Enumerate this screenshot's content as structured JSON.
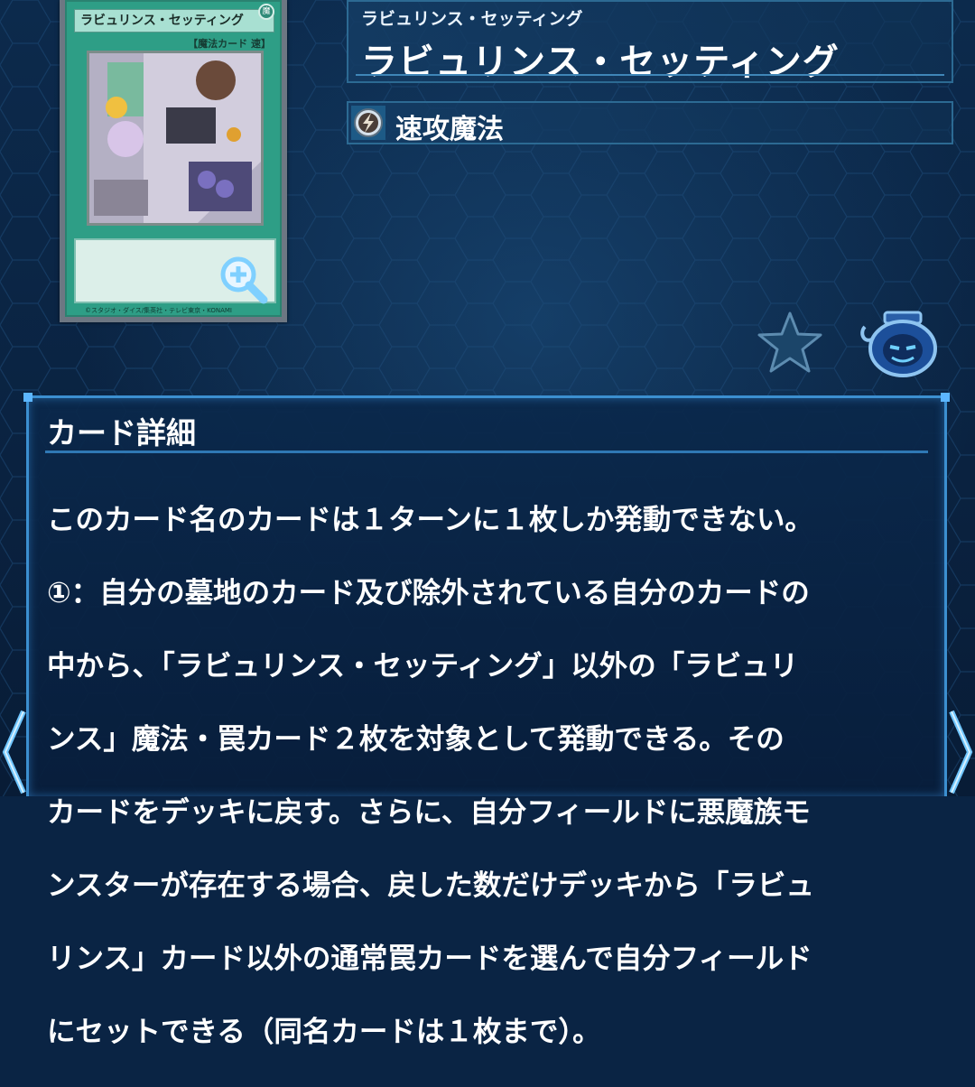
{
  "card": {
    "small_name": "ラビュリンス・セッティング",
    "attribute_mark": "魔",
    "small_type": "【魔法カード 速】",
    "footer": "©スタジオ・ダイス/集英社・テレビ東京・KONAMI"
  },
  "header": {
    "ruby": "ラビュリンス・セッティング",
    "title": "ラビュリンス・セッティング"
  },
  "type": {
    "label": "速攻魔法",
    "icon": "quick-play-spell-icon"
  },
  "actions": {
    "favorite_icon": "star-icon",
    "pot_icon": "pot-of-greed-icon"
  },
  "details": {
    "heading": "カード詳細",
    "lines": [
      "このカード名のカードは１ターンに１枚しか発動できない。",
      "①：自分の墓地のカード及び除外されている自分のカードの",
      "中から、「ラビュリンス・セッティング」以外の「ラビュリ",
      "ンス」魔法・罠カード２枚を対象として発動できる。その",
      "カードをデッキに戻す。さらに、自分フィールドに悪魔族モ",
      "ンスターが存在する場合、戻した数だけデッキから「ラビュ",
      "リンス」カード以外の通常罠カードを選んで自分フィールド",
      "にセットできる（同名カードは１枚まで）。"
    ]
  },
  "colors": {
    "background": "#0a2444",
    "frame": "#3c8fd0",
    "spell_card": "#2e9e86"
  }
}
